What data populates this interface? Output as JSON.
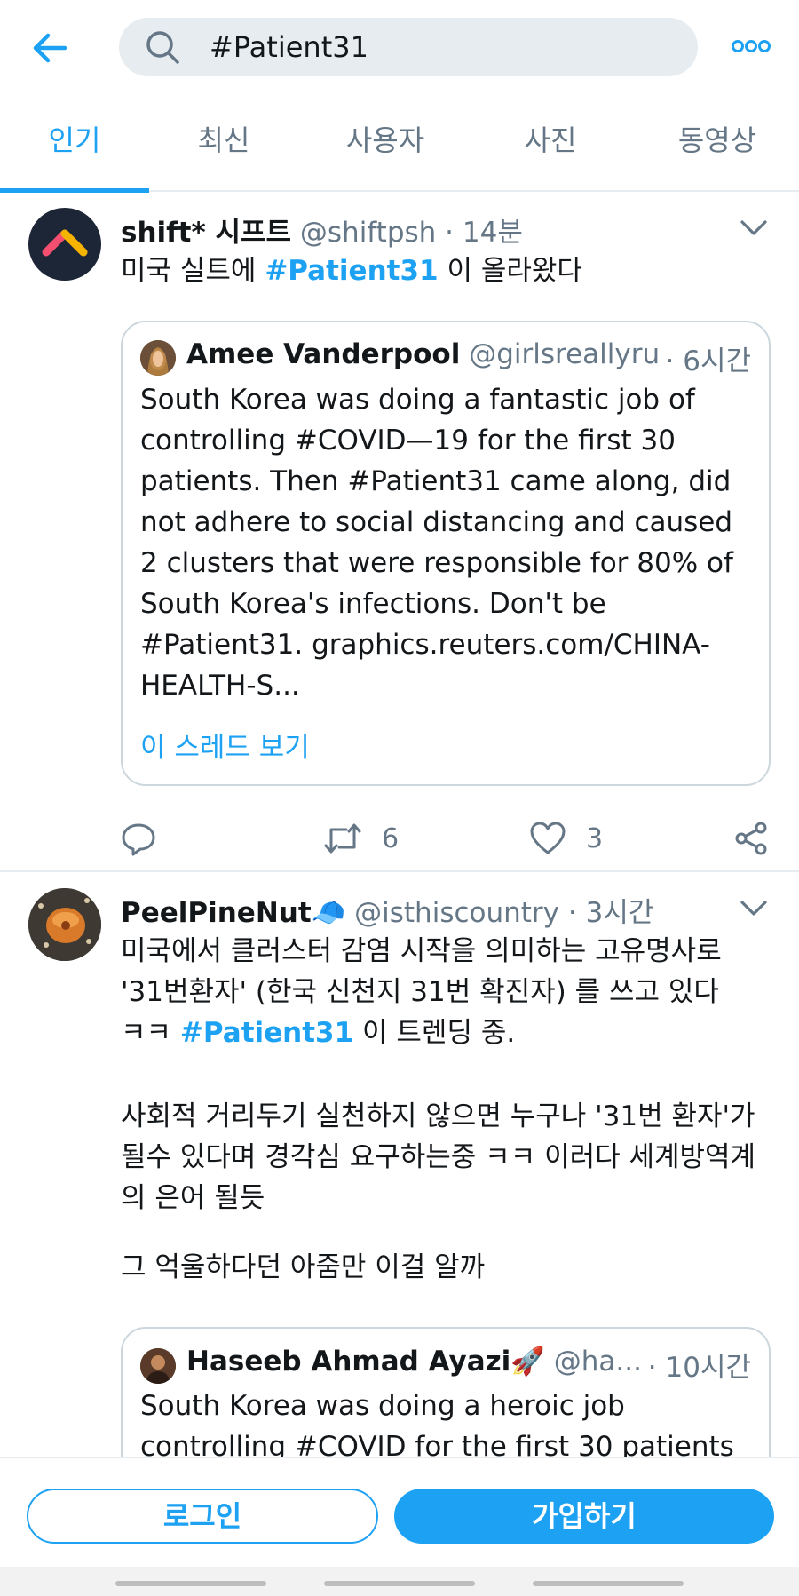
{
  "search": {
    "query": "#Patient31"
  },
  "tabs": [
    {
      "label": "인기",
      "active": true
    },
    {
      "label": "최신",
      "active": false
    },
    {
      "label": "사용자",
      "active": false
    },
    {
      "label": "사진",
      "active": false
    },
    {
      "label": "동영상",
      "active": false
    }
  ],
  "tweets": [
    {
      "name": "shift* 시프트",
      "handle": "@shiftpsh",
      "time": "· 14분",
      "text_before": "미국 실트에 ",
      "hashtag": "#Patient31",
      "text_after": " 이 올라왔다",
      "quote": {
        "name": "Amee Vanderpool",
        "handle": "@girlsreallyru...",
        "time": "· 6시간",
        "text": "South Korea was doing a fantastic job of controlling #COVID—19 for the first 30 patients. Then #Patient31 came along, did not adhere to social distancing and caused 2 clusters that were responsible for 80% of South Korea's infections. Don't be #Patient31. graphics.reuters.com/CHINA-HEALTH-S...",
        "thread_link": "이 스레드 보기"
      },
      "actions": {
        "retweets": "6",
        "likes": "3"
      }
    },
    {
      "name": "PeelPineNut",
      "name_emoji": "🧢",
      "handle": "@isthiscountry",
      "time": "· 3시간",
      "text_line1": "미국에서 클러스터 감염 시작을 의미하는 고유명사로",
      "text_line2": "'31번환자' (한국 신천지 31번 확진자) 를 쓰고 있다",
      "text_line3_before": "ㅋㅋ ",
      "hashtag": "#Patient31",
      "text_line3_after": " 이 트렌딩 중.",
      "paragraph2": "사회적 거리두기 실천하지 않으면 누구나 '31번 환자'가 될수 있다며 경각심 요구하는중 ㅋㅋ 이러다 세계방역계의 은어 될듯",
      "paragraph3": "그 억울하다던 아줌만 이걸 알까",
      "quote": {
        "name": "Haseeb Ahmad Ayazi",
        "name_emoji": "🚀",
        "handle": "@ha...",
        "time": "· 10시간",
        "text": "South Korea was doing a heroic job controlling #COVID for the first 30 patients"
      }
    }
  ],
  "bottom": {
    "login_label": "로그인",
    "signup_label": "가입하기"
  },
  "colors": {
    "accent": "#1da1f2",
    "secondary_text": "#657786",
    "border": "#e6ecf0"
  }
}
